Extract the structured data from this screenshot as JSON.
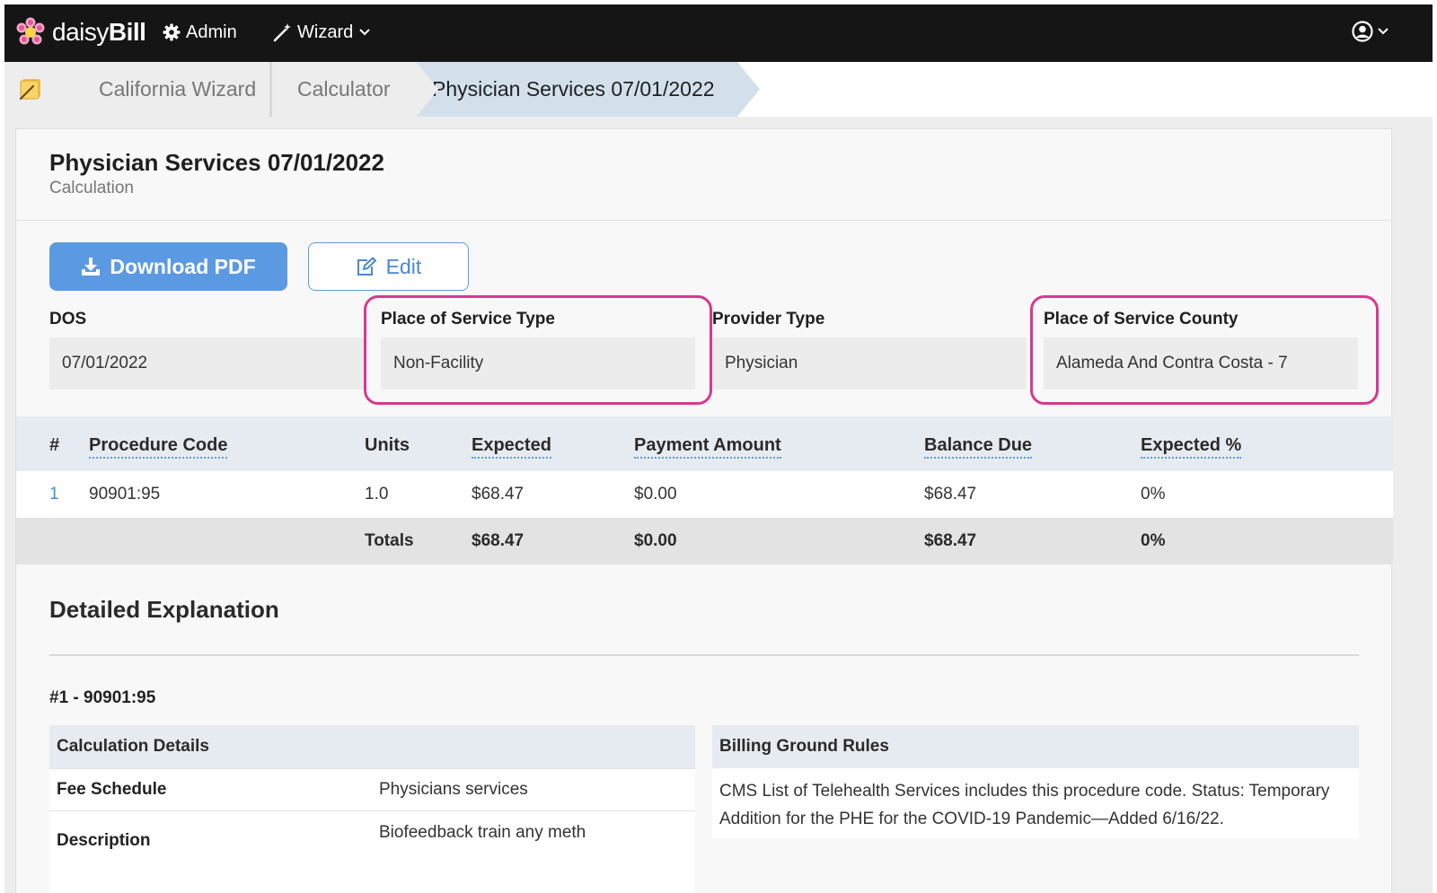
{
  "app": {
    "brand_light": "daisy",
    "brand_bold": "Bill",
    "nav": {
      "admin": "Admin",
      "wizard": "Wizard"
    },
    "accent_color": "#5b9ae2",
    "highlight_color": "#d8388f"
  },
  "breadcrumb": [
    "California Wizard",
    "Calculator",
    "Physician Services 07/01/2022"
  ],
  "page": {
    "title": "Physician Services 07/01/2022",
    "subtitle": "Calculation",
    "download_label": "Download PDF",
    "edit_label": "Edit"
  },
  "fields": {
    "dos": {
      "label": "DOS",
      "value": "07/01/2022"
    },
    "pos_type": {
      "label": "Place of Service Type",
      "value": "Non-Facility"
    },
    "provider_type": {
      "label": "Provider Type",
      "value": "Physician"
    },
    "pos_county": {
      "label": "Place of Service County",
      "value": "Alameda And Contra Costa - 7"
    }
  },
  "table": {
    "headers": [
      "#",
      "Procedure Code",
      "Units",
      "Expected",
      "Payment Amount",
      "Balance Due",
      "Expected %"
    ],
    "rows": [
      {
        "num": "1",
        "code": "90901:95",
        "units": "1.0",
        "expected": "$68.47",
        "payment": "$0.00",
        "balance": "$68.47",
        "pct": "0%"
      }
    ],
    "totals": {
      "label": "Totals",
      "expected": "$68.47",
      "payment": "$0.00",
      "balance": "$68.47",
      "pct": "0%"
    }
  },
  "explanation": {
    "title": "Detailed Explanation",
    "item_heading": "#1 - 90901:95",
    "calc_details_title": "Calculation Details",
    "rows": [
      {
        "label": "Fee Schedule",
        "value": "Physicians services"
      },
      {
        "label": "Description",
        "value": "Biofeedback train any meth"
      }
    ],
    "rules_title": "Billing Ground Rules",
    "rules_text": "CMS List of Telehealth Services includes this procedure code. Status: Temporary Addition for the PHE for the COVID-19 Pandemic—Added 6/16/22."
  }
}
